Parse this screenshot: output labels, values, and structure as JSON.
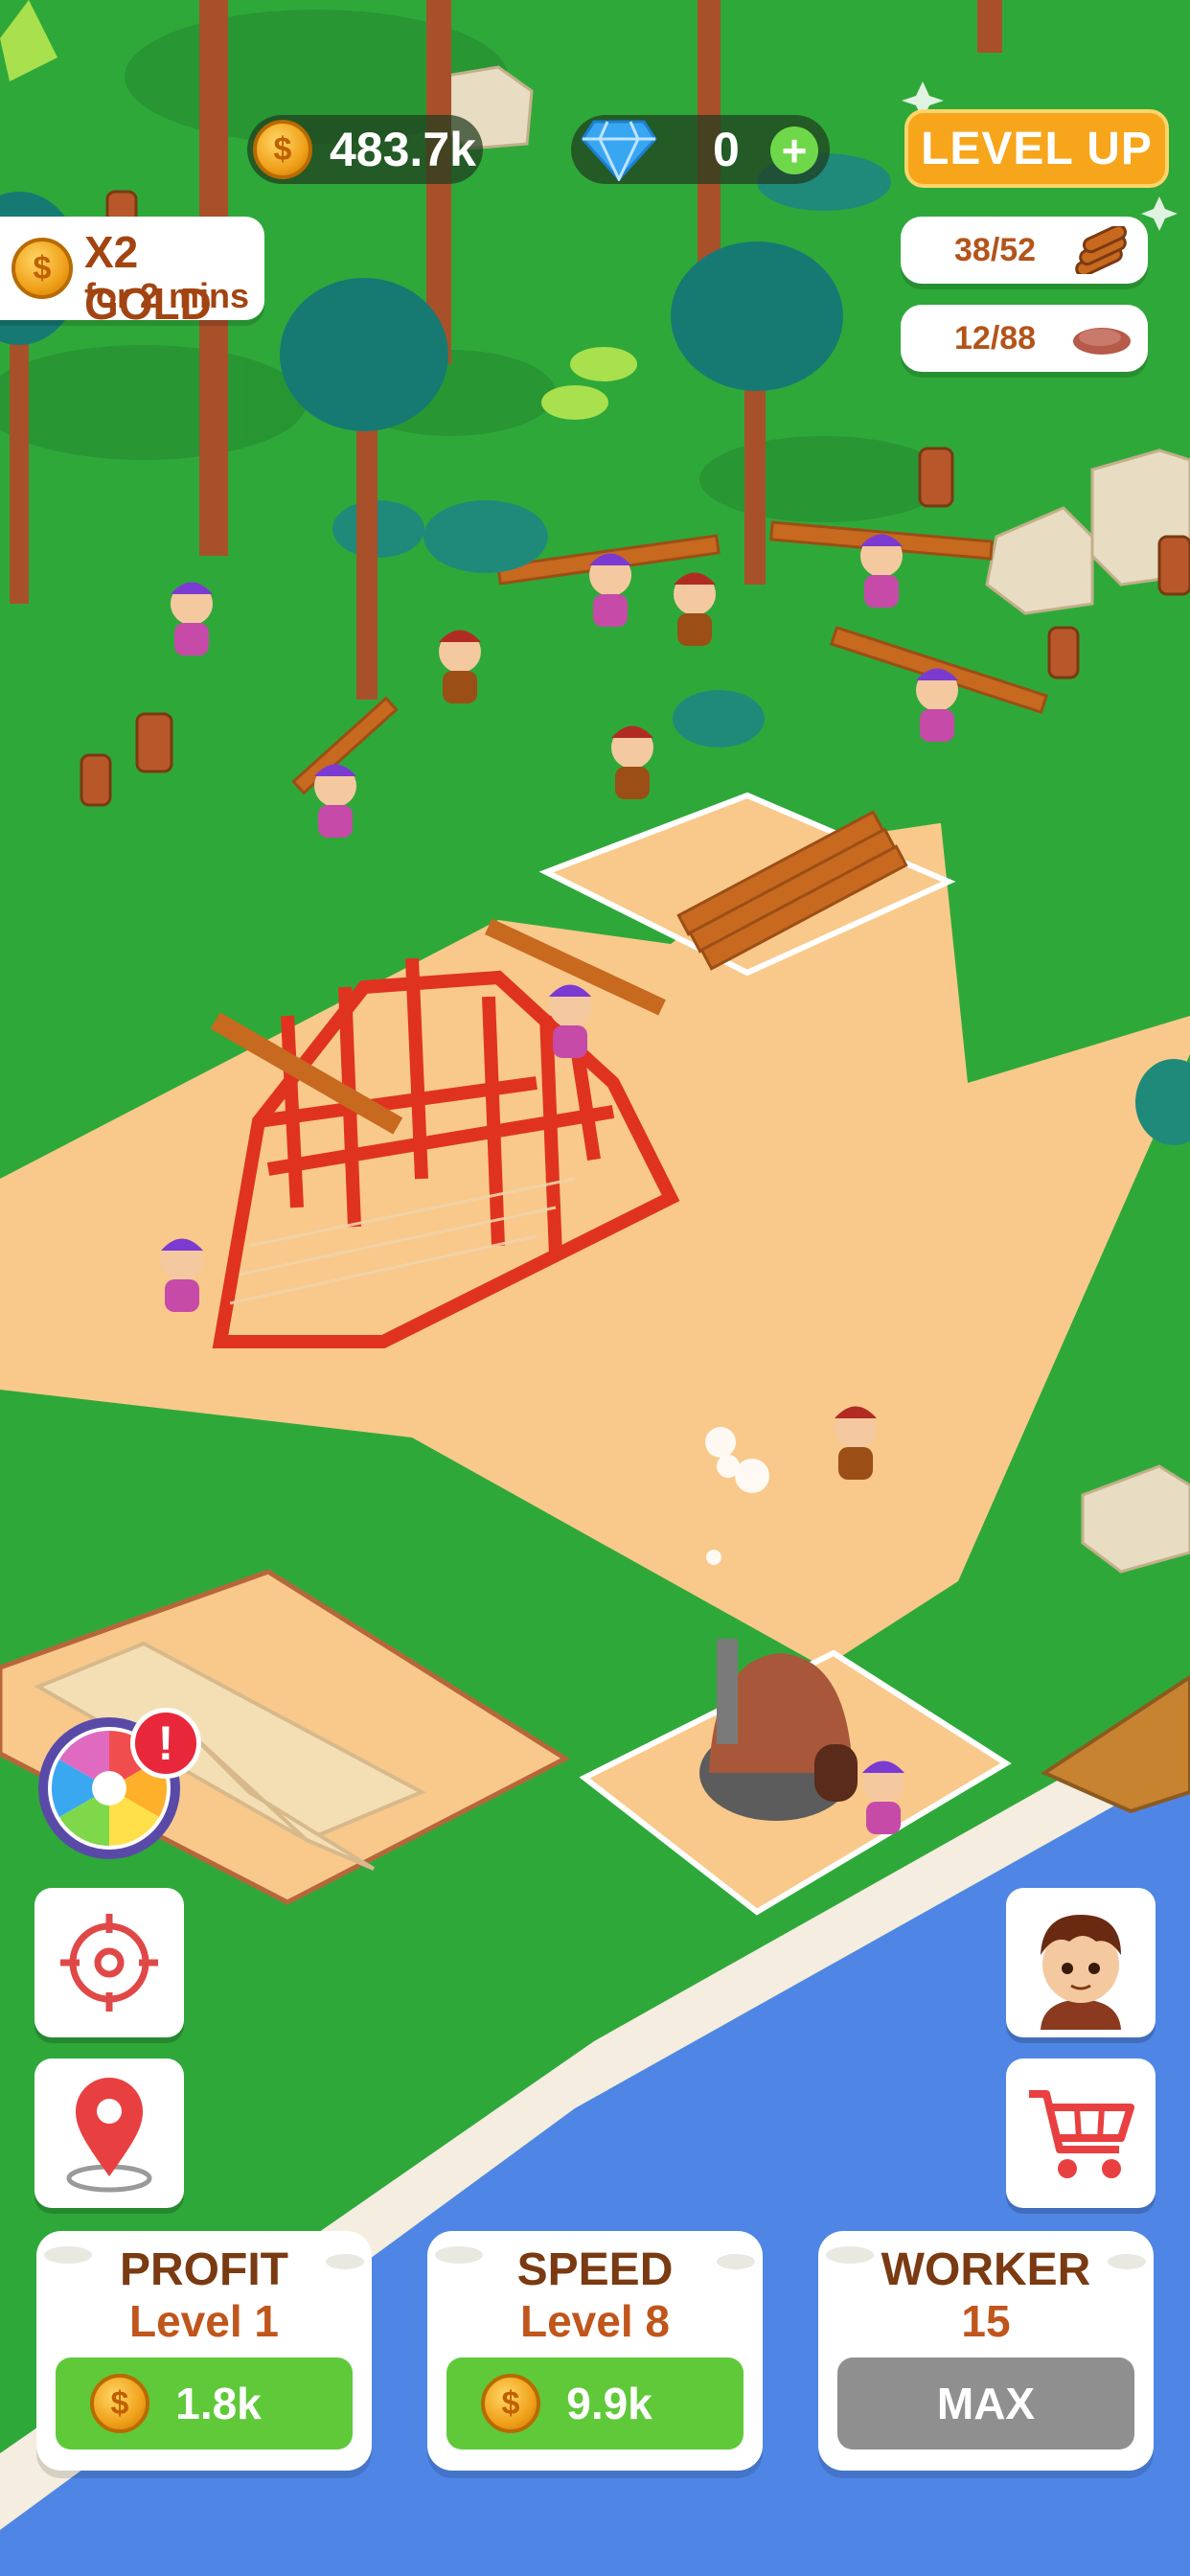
{
  "hud": {
    "gold_amount": "483.7k",
    "gem_amount": "0",
    "level_up_label": "LEVEL UP",
    "boost_title": "X2 GOLD",
    "boost_subtitle": "for 2 mins",
    "wood_count": "38/52",
    "meat_count": "12/88"
  },
  "upgrades": [
    {
      "title": "PROFIT",
      "level": "Level 1",
      "cost": "1.8k"
    },
    {
      "title": "SPEED",
      "level": "Level 8",
      "cost": "9.9k"
    },
    {
      "title": "WORKER",
      "level": "15",
      "cost": "MAX"
    }
  ],
  "colors": {
    "grass": "#2fa83a",
    "sand": "#f8c98b",
    "water": "#4f86e6",
    "level_up": "#f7a51b",
    "buy_green": "#5fc93a",
    "max_gray": "#8f8f8f"
  },
  "icons": {
    "spin_wheel": "spin-wheel-icon",
    "alert": "exclamation-icon",
    "target": "crosshair-icon",
    "location": "map-pin-icon",
    "avatar": "caveman-avatar-icon",
    "shop": "shopping-cart-icon"
  }
}
